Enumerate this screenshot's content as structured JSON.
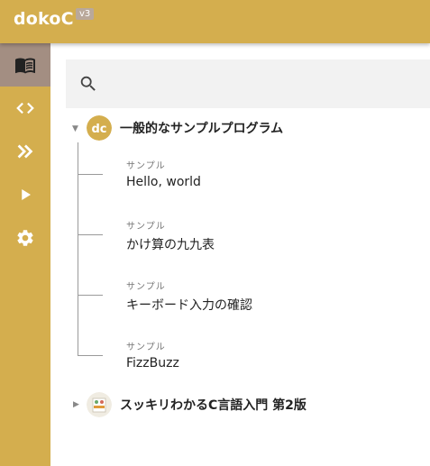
{
  "app": {
    "title": "dokoC",
    "version": "v3"
  },
  "sidebar": {
    "items": [
      {
        "icon": "book-icon",
        "active": true
      },
      {
        "icon": "code-icon",
        "active": false
      },
      {
        "icon": "double-chevron-right-icon",
        "active": false
      },
      {
        "icon": "play-icon",
        "active": false
      },
      {
        "icon": "gear-icon",
        "active": false
      }
    ]
  },
  "search": {
    "placeholder": ""
  },
  "tree": {
    "groups": [
      {
        "title": "一般的なサンプルプログラム",
        "expanded": true,
        "items": [
          {
            "type": "サンプル",
            "name": "Hello, world"
          },
          {
            "type": "サンプル",
            "name": "かけ算の九九表"
          },
          {
            "type": "サンプル",
            "name": "キーボード入力の確認"
          },
          {
            "type": "サンプル",
            "name": "FizzBuzz"
          }
        ]
      },
      {
        "title": "スッキリわかるC言語入門 第2版",
        "expanded": false,
        "items": []
      }
    ]
  },
  "colors": {
    "accent": "#d4ae4e",
    "active": "#a38e82",
    "badge": "#b9a89a"
  }
}
